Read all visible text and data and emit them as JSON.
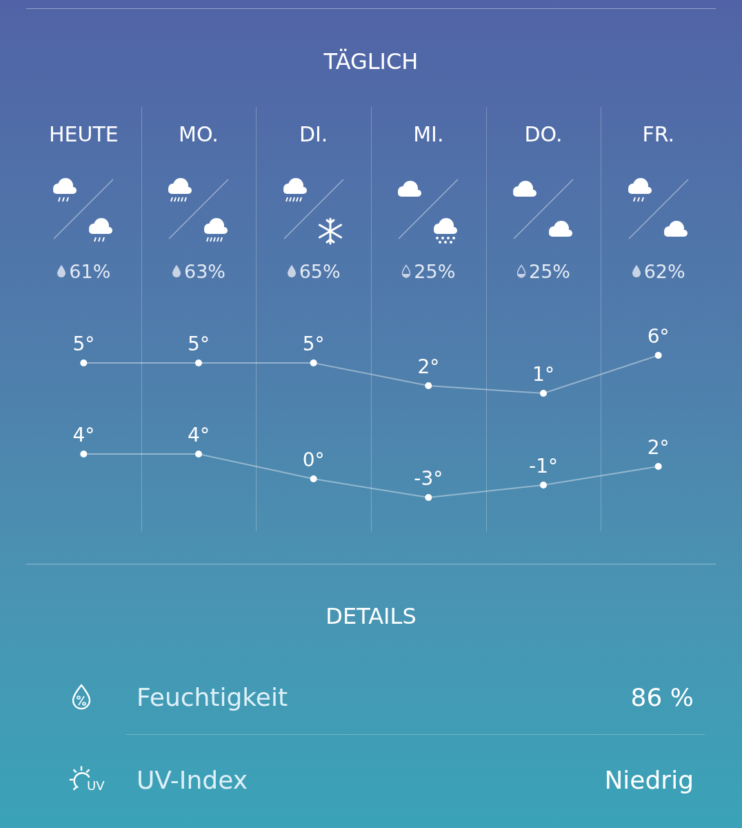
{
  "daily": {
    "title": "TÄGLICH",
    "days": [
      {
        "label": "HEUTE",
        "icons": [
          {
            "kind": "rain_light"
          },
          {
            "kind": "rain_light"
          }
        ],
        "drop": {
          "kind": "full"
        },
        "precip": "61%"
      },
      {
        "label": "MO.",
        "icons": [
          {
            "kind": "rain_heavy"
          },
          {
            "kind": "rain_heavy"
          }
        ],
        "drop": {
          "kind": "full"
        },
        "precip": "63%"
      },
      {
        "label": "DI.",
        "icons": [
          {
            "kind": "rain_heavy"
          },
          {
            "kind": "snow"
          }
        ],
        "drop": {
          "kind": "full"
        },
        "precip": "65%"
      },
      {
        "label": "MI.",
        "icons": [
          {
            "kind": "cloud"
          },
          {
            "kind": "snow_cloud"
          }
        ],
        "drop": {
          "kind": "low"
        },
        "precip": "25%"
      },
      {
        "label": "DO.",
        "icons": [
          {
            "kind": "cloud"
          },
          {
            "kind": "cloud"
          }
        ],
        "drop": {
          "kind": "low"
        },
        "precip": "25%"
      },
      {
        "label": "FR.",
        "icons": [
          {
            "kind": "rain_light"
          },
          {
            "kind": "cloud"
          }
        ],
        "drop": {
          "kind": "full"
        },
        "precip": "62%"
      }
    ],
    "temperatures": [
      {
        "chart_data": {
          "type": "line",
          "series": [
            {
              "color": "#ffffff",
              "marker": true,
              "values": [
                5,
                5,
                5,
                2,
                1,
                6
              ],
              "value_labels": [
                "5°",
                "5°",
                "5°",
                "2°",
                "1°",
                "6°"
              ]
            }
          ]
        }
      },
      {
        "chart_data": {
          "type": "line",
          "series": [
            {
              "color": "#ffffff",
              "marker": true,
              "values": [
                4,
                4,
                0,
                -3,
                -1,
                2
              ],
              "value_labels": [
                "4°",
                "4°",
                "0°",
                "-3°",
                "-1°",
                "2°"
              ]
            }
          ]
        }
      }
    ]
  },
  "details": {
    "title": "DETAILS",
    "rows": [
      {
        "kind": "humidity",
        "label": "Feuchtigkeit",
        "value": "86 %"
      },
      {
        "kind": "uv",
        "icon_text": "UV",
        "label": "UV-Index",
        "value": "Niedrig"
      }
    ]
  }
}
